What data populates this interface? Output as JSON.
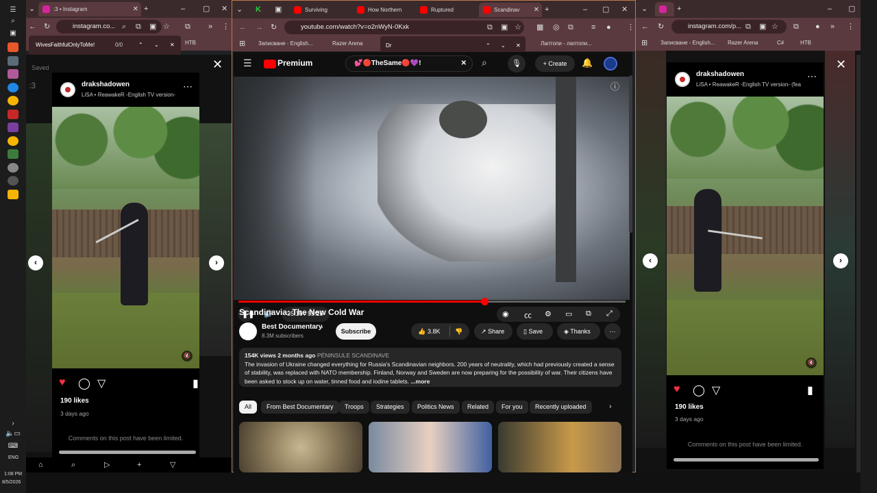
{
  "taskbar": {
    "time": "1:08 PM",
    "date": "8/5/2026",
    "lang": "ENG"
  },
  "left": {
    "tab_title": ":3 • Instagram",
    "url": "instagram.co...",
    "find_query": "WivesFaithfulOnlyToMe!",
    "find_count": "0/0",
    "bookmark": "НТВ",
    "saved_label": "Saved",
    "post": {
      "user": "drakshadowen",
      "song": "LiSA • ReawakeR -English TV version-",
      "likes": "190 likes",
      "ago": "3 days ago",
      "comments_limited": "Comments on this post have been limited."
    }
  },
  "middle": {
    "tabs": [
      "Surviving",
      "How Northern",
      "Ruptured",
      "Scandinav"
    ],
    "url": "youtube.com/watch?v=o2nWyN-0Kxk",
    "find_query": "Dr",
    "bookmarks": [
      "Записване - English...",
      "Razer Arena",
      "Лаптопи - лаптопи..."
    ],
    "yt": {
      "logo": "Premium",
      "search_query": "💕🔴TheSame🔴💜!",
      "create": "Create",
      "time": "35:16 / 55:25",
      "progress": 0.636,
      "title": "Scandinavia: The New Cold War",
      "channel": "Best Documentary",
      "subs": "8.3M subscribers",
      "subscribe": "Subscribe",
      "likes": "3.8K",
      "share": "Share",
      "save": "Save",
      "thanks": "Thanks",
      "meta": "154K views  2 months ago",
      "tag": "PÉNINSULE SCANDINAVE",
      "description": "The invasion of Ukraine changed everything for Russia's Scandinavian neighbors. 200 years of neutrality, which had previously created a sense of stability, was replaced with NATO membership. Finland, Norway and Sweden are now preparing for the possibility of war. Their citizens have been asked to stock up on water, tinned food and iodine tablets.",
      "more": "...more",
      "chips": [
        "All",
        "From Best Documentary",
        "Troops",
        "Strategies",
        "Politics News",
        "Related",
        "For you",
        "Recently uploaded"
      ]
    }
  },
  "right": {
    "url": "instagram.com/p...",
    "bookmarks": [
      "Записване - English...",
      "Razer Arena",
      "C#",
      "НТВ"
    ],
    "post": {
      "user": "drakshadowen",
      "song": "LiSA • ReawakeR -English TV version- (fea",
      "likes": "190 likes",
      "ago": "3 days ago",
      "comments_limited": "Comments on this post have been limited."
    }
  }
}
